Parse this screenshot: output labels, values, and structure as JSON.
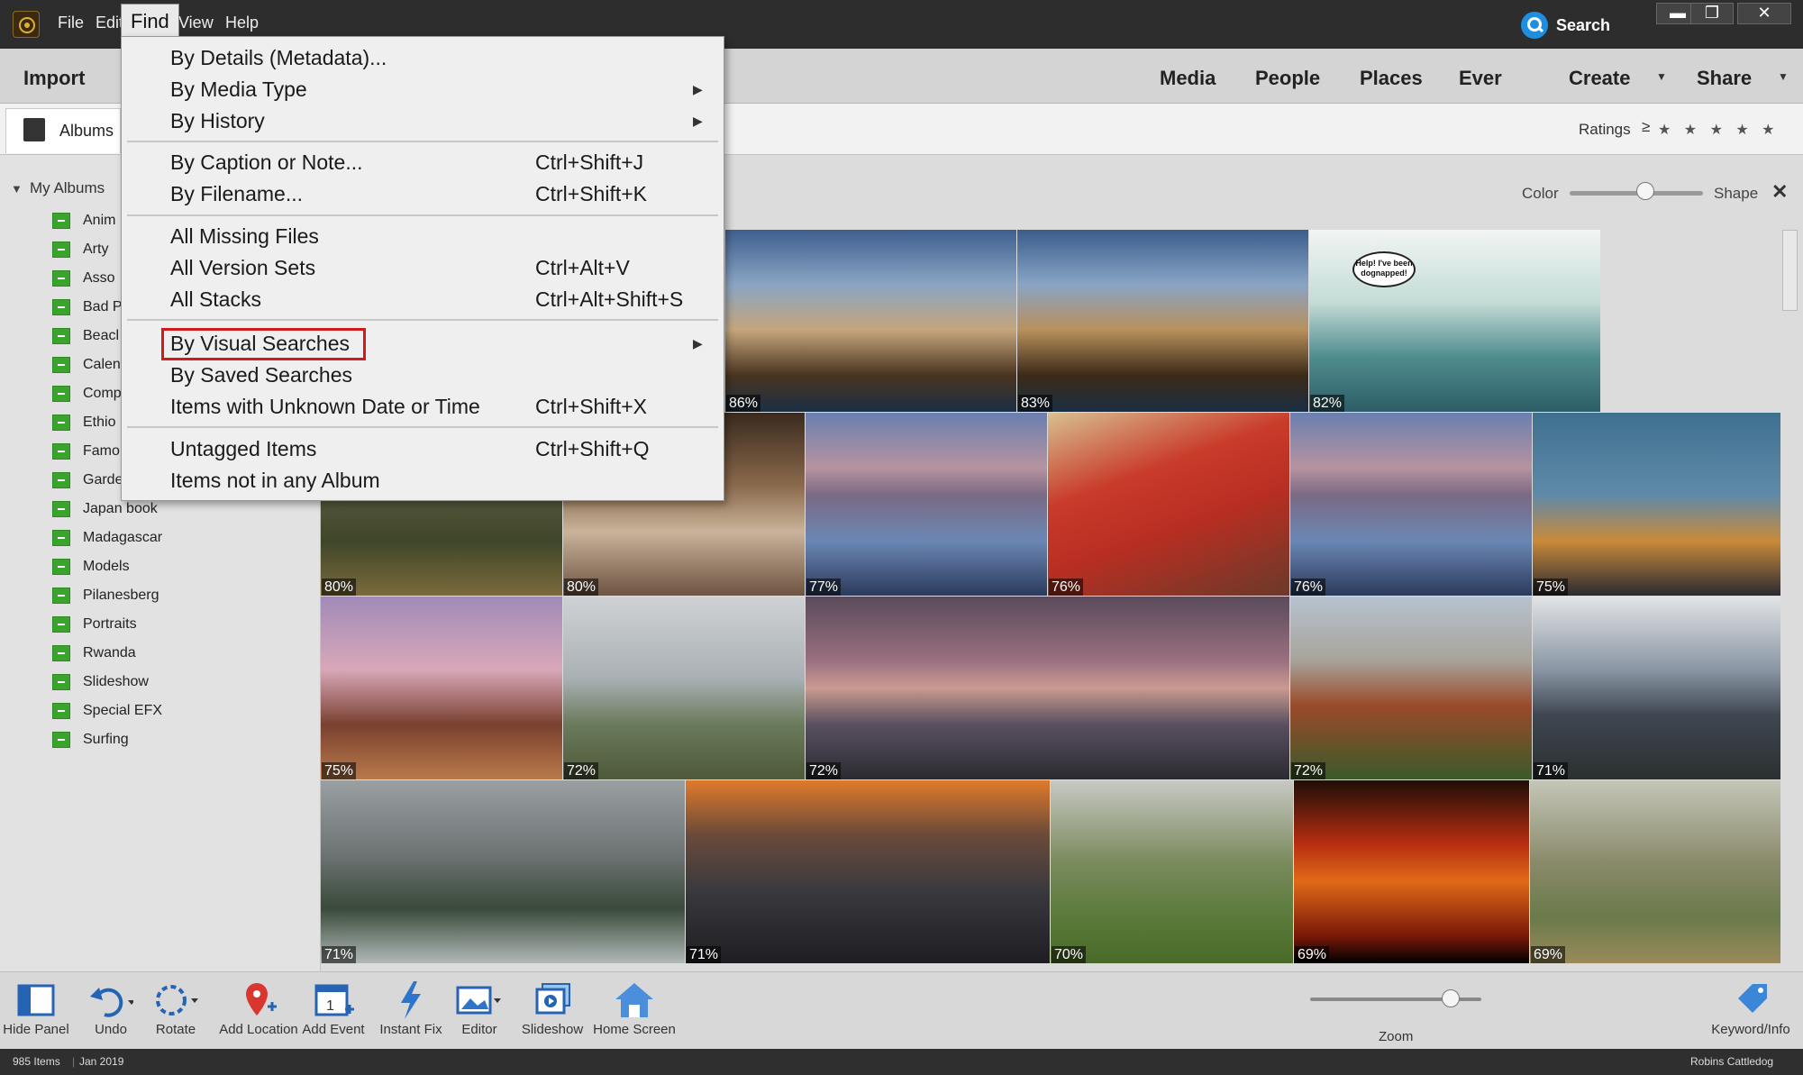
{
  "menubar": {
    "file": "File",
    "edit": "Edit",
    "find": "Find",
    "view": "View",
    "help": "Help"
  },
  "search": {
    "label": "Search"
  },
  "window_controls": {
    "minimize": "▬",
    "maximize": "❐",
    "close": "✕"
  },
  "modes": {
    "import": "Import",
    "media": "Media",
    "people": "People",
    "places": "Places",
    "events": "Ever",
    "create": "Create",
    "share": "Share"
  },
  "tabs": {
    "albums": "Albums"
  },
  "ratings": {
    "label": "Ratings",
    "operator": "≥",
    "stars": "★ ★ ★ ★ ★"
  },
  "sidebar": {
    "section": "My Albums",
    "albums": [
      "Anim",
      "Arty",
      "Asso",
      "Bad P",
      "Beacl",
      "Calen",
      "Comp",
      "Ethio",
      "Famo",
      "Garde",
      "Japan book",
      "Madagascar",
      "Models",
      "Pilanesberg",
      "Portraits",
      "Rwanda",
      "Slideshow",
      "Special EFX",
      "Surfing"
    ]
  },
  "filter": {
    "color_label": "Color",
    "shape_label": "Shape",
    "close": "✕",
    "slider_value": 0.57
  },
  "grid": {
    "percentages": [
      "86%",
      "83%",
      "82%",
      "80%",
      "80%",
      "77%",
      "76%",
      "76%",
      "75%",
      "75%",
      "72%",
      "72%",
      "72%",
      "71%",
      "71%",
      "71%",
      "70%",
      "69%",
      "69%"
    ],
    "cartoon_text": "Help! I've been dognapped!"
  },
  "toolbar": {
    "hide_panel": "Hide Panel",
    "undo": "Undo",
    "rotate": "Rotate",
    "add_location": "Add Location",
    "add_event": "Add Event",
    "instant_fix": "Instant Fix",
    "editor": "Editor",
    "slideshow": "Slideshow",
    "home_screen": "Home Screen",
    "zoom": "Zoom",
    "keyword_info": "Keyword/Info",
    "zoom_value": 0.82
  },
  "status": {
    "items": "985 Items",
    "date": "Jan 2019",
    "user": "Robins Cattledog"
  },
  "find_menu": {
    "by_details": "By Details (Metadata)...",
    "by_media_type": "By Media Type",
    "by_history": "By History",
    "by_caption": "By Caption or Note...",
    "by_caption_sc": "Ctrl+Shift+J",
    "by_filename": "By Filename...",
    "by_filename_sc": "Ctrl+Shift+K",
    "missing_files": "All Missing Files",
    "version_sets": "All Version Sets",
    "version_sets_sc": "Ctrl+Alt+V",
    "stacks": "All Stacks",
    "stacks_sc": "Ctrl+Alt+Shift+S",
    "visual_searches": "By Visual Searches",
    "saved_searches": "By Saved Searches",
    "unknown_date": "Items with Unknown Date or Time",
    "unknown_date_sc": "Ctrl+Shift+X",
    "untagged": "Untagged Items",
    "untagged_sc": "Ctrl+Shift+Q",
    "not_in_album": "Items not in any Album"
  },
  "colors": {
    "accent": "#1e8fe0",
    "album_green": "#3aa42f",
    "highlight": "#d11a1a"
  }
}
